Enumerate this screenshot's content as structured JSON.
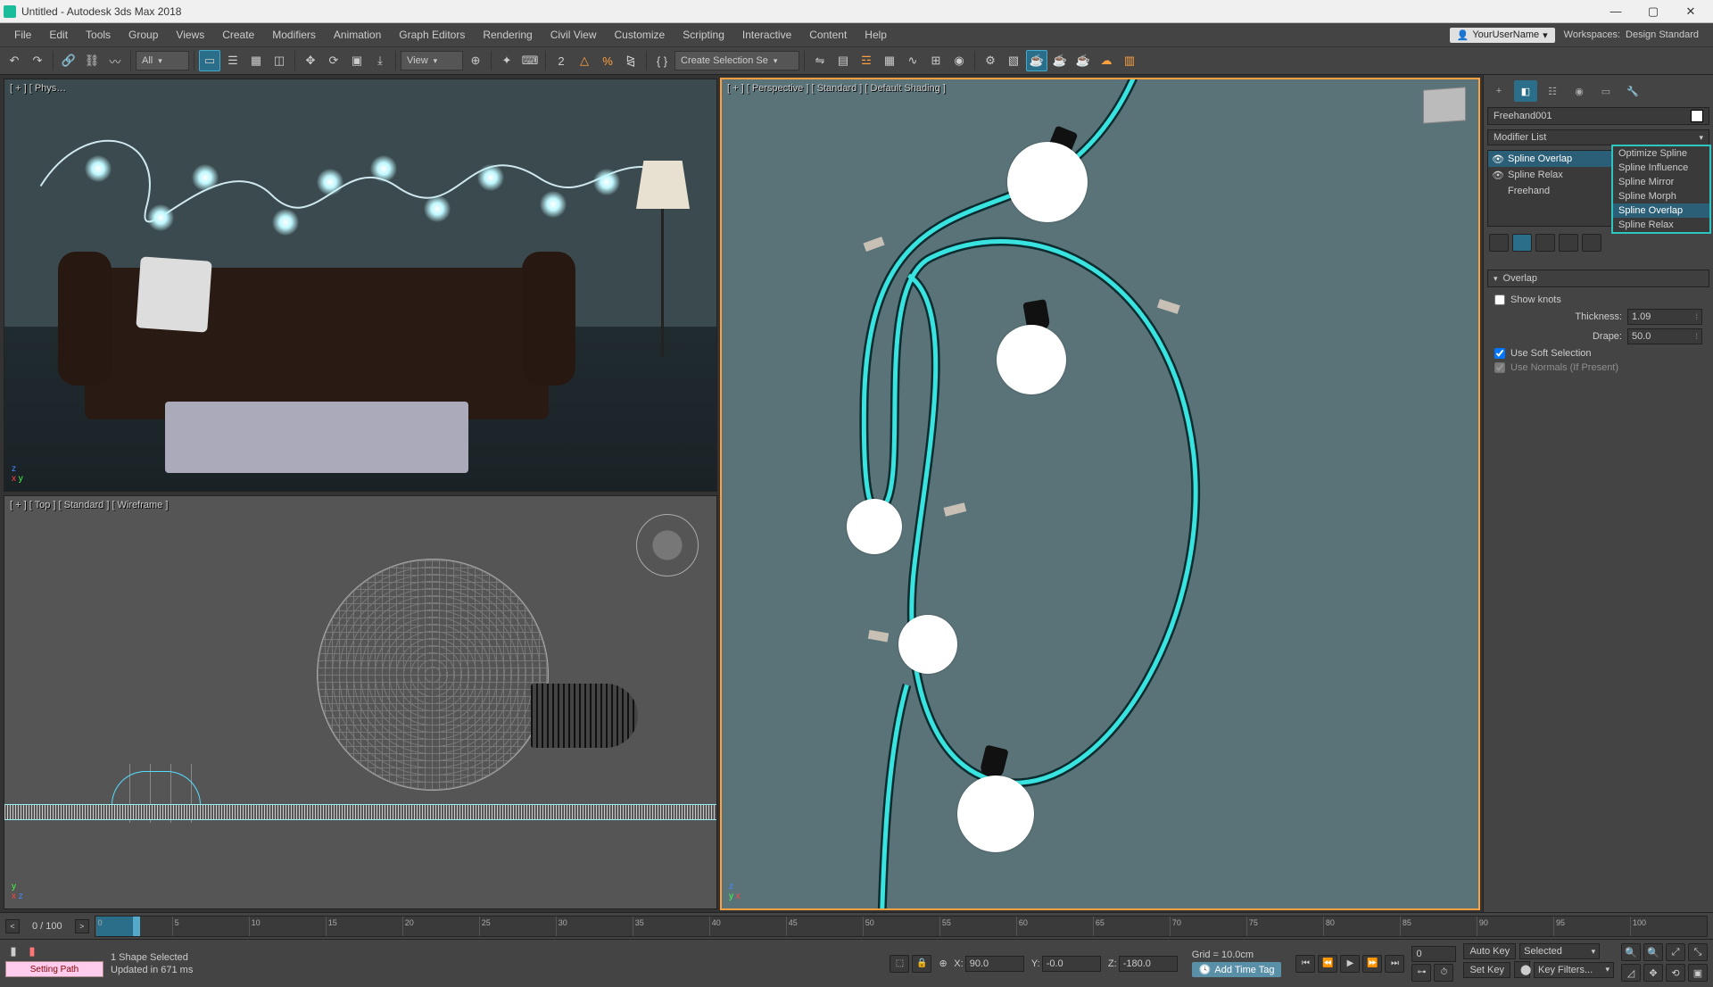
{
  "titlebar": {
    "title": "Untitled - Autodesk 3ds Max 2018"
  },
  "menu": [
    "File",
    "Edit",
    "Tools",
    "Group",
    "Views",
    "Create",
    "Modifiers",
    "Animation",
    "Graph Editors",
    "Rendering",
    "Civil View",
    "Customize",
    "Scripting",
    "Interactive",
    "Content",
    "Help"
  ],
  "user": {
    "name": "YourUserName"
  },
  "workspace": {
    "label": "Workspaces:",
    "value": "Design Standard"
  },
  "toolbar": {
    "filter_dropdown": "All",
    "selection_dropdown": "Create Selection Se",
    "view_dropdown": "View"
  },
  "viewports": {
    "tl": "[ + ] [ Phys…",
    "bl": "[ + ] [ Top ] [ Standard ] [ Wireframe ]",
    "r": "[ + ] [ Perspective ] [ Standard ] [ Default Shading ]"
  },
  "cmdpanel": {
    "object_name": "Freehand001",
    "modlist_label": "Modifier List",
    "dropdown_options": [
      "Optimize Spline",
      "Spline Influence",
      "Spline Mirror",
      "Spline Morph",
      "Spline Overlap",
      "Spline Relax"
    ],
    "stack": [
      {
        "name": "Spline Overlap",
        "selected": true,
        "eye": true
      },
      {
        "name": "Spline Relax",
        "selected": false,
        "eye": true
      },
      {
        "name": "Freehand",
        "selected": false,
        "eye": false
      }
    ],
    "rollout_title": "Overlap",
    "show_knots": "Show knots",
    "thickness_label": "Thickness:",
    "thickness_value": "1.09",
    "drape_label": "Drape:",
    "drape_value": "50.0",
    "soft_sel": "Use Soft Selection",
    "normals": "Use Normals (If Present)"
  },
  "timeline": {
    "counter": "0 / 100",
    "ticks": [
      "0",
      "5",
      "10",
      "15",
      "20",
      "25",
      "30",
      "35",
      "40",
      "45",
      "50",
      "55",
      "60",
      "65",
      "70",
      "75",
      "80",
      "85",
      "90",
      "95",
      "100"
    ]
  },
  "status": {
    "script": "Setting Path",
    "selection": "1 Shape Selected",
    "update": "Updated in 671 ms",
    "x": "90.0",
    "y": "-0.0",
    "z": "-180.0",
    "grid": "Grid = 10.0cm",
    "time_tag": "Add Time Tag",
    "auto_key": "Auto Key",
    "set_key": "Set Key",
    "selected": "Selected",
    "key_filters": "Key Filters..."
  }
}
